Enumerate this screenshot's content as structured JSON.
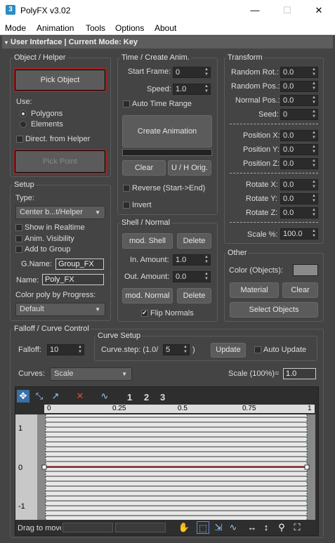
{
  "window": {
    "title": "PolyFX v3.02",
    "icon": "3",
    "minimize": "—",
    "maximize": "☐",
    "close": "✕"
  },
  "menu": [
    "Mode",
    "Animation",
    "Tools",
    "Options",
    "About"
  ],
  "rollout": {
    "title": "User Interface | Current Mode: Key"
  },
  "object_helper": {
    "title": "Object / Helper",
    "pick_object": "Pick Object",
    "use_label": "Use:",
    "polygons": "Polygons",
    "elements": "Elements",
    "direct_from_helper": "Direct. from Helper",
    "pick_point": "Pick Point"
  },
  "setup": {
    "title": "Setup",
    "type_label": "Type:",
    "type_value": "Center b...t/Helper",
    "show_realtime": "Show in Realtime",
    "anim_visibility": "Anim. Visibility",
    "add_to_group": "Add to Group",
    "gname_label": "G.Name:",
    "gname_value": "Group_FX",
    "name_label": "Name:",
    "name_value": "Poly_FX",
    "color_by_progress": "Color poly by Progress:",
    "color_value": "Default"
  },
  "time_create": {
    "title": "Time / Create Anim.",
    "start_frame_label": "Start Frame:",
    "start_frame": "0",
    "speed_label": "Speed:",
    "speed": "1.0",
    "auto_time_range": "Auto Time Range",
    "create_animation": "Create Animation",
    "clear": "Clear",
    "uh_orig": "U / H Orig.",
    "reverse": "Reverse (Start->End)",
    "invert": "Invert"
  },
  "shell_normal": {
    "title": "Shell / Normal",
    "mod_shell": "mod. Shell",
    "delete1": "Delete",
    "in_amount_label": "In. Amount:",
    "in_amount": "1.0",
    "out_amount_label": "Out. Amount:",
    "out_amount": "0.0",
    "mod_normal": "mod. Normal",
    "delete2": "Delete",
    "flip_normals": "Flip Normals"
  },
  "transform": {
    "title": "Transform",
    "random_rot_label": "Random Rot.:",
    "random_rot": "0.0",
    "random_pos_label": "Random Pos.:",
    "random_pos": "0.0",
    "normal_pos_label": "Normal Pos.:",
    "normal_pos": "0.0",
    "seed_label": "Seed:",
    "seed": "0",
    "position_x_label": "Position X:",
    "position_x": "0.0",
    "position_y_label": "Position Y:",
    "position_y": "0.0",
    "position_z_label": "Position Z:",
    "position_z": "0.0",
    "rotate_x_label": "Rotate X:",
    "rotate_x": "0.0",
    "rotate_y_label": "Rotate Y:",
    "rotate_y": "0.0",
    "rotate_z_label": "Rotate Z:",
    "rotate_z": "0.0",
    "scale_label": "Scale %:",
    "scale": "100.0"
  },
  "other": {
    "title": "Other",
    "color_objects_label": "Color (Objects):",
    "material": "Material",
    "clear": "Clear",
    "select_objects": "Select Objects",
    "swatch_color": "#8a8a8a"
  },
  "falloff": {
    "title": "Falloff / Curve Control",
    "falloff_label": "Falloff:",
    "falloff_value": "10",
    "curve_setup_title": "Curve Setup",
    "curve_step_label": "Curve.step: (1.0/",
    "curve_step_value": "5",
    "curve_step_close": ")",
    "update": "Update",
    "auto_update": "Auto Update",
    "curves_label": "Curves:",
    "curves_value": "Scale",
    "scale_label": "Scale (100%)=",
    "scale_value": "1.0"
  },
  "curve_editor": {
    "toolbar_numbers": [
      "1",
      "2",
      "3"
    ],
    "ruler": [
      "0",
      "0.25",
      "0.5",
      "0.75",
      "1"
    ],
    "y_labels": [
      "1",
      "0",
      "-1"
    ],
    "status_text": "Drag to move",
    "curve_color": "#a01818"
  }
}
